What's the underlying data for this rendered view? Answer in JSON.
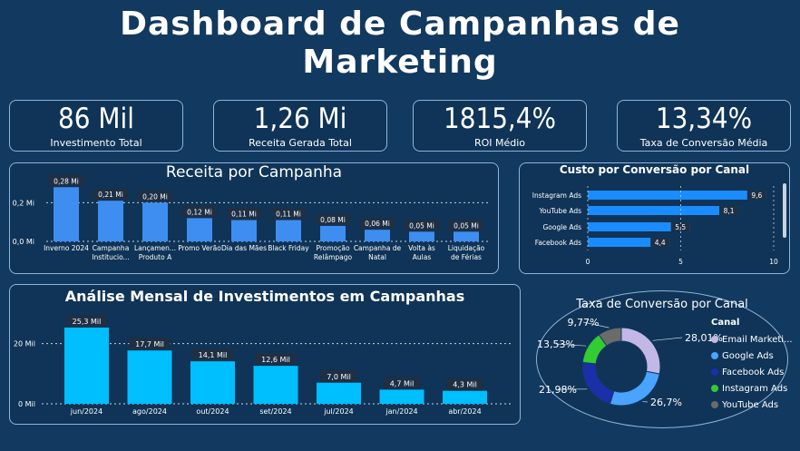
{
  "title_line1": "Dashboard de Campanhas  de",
  "title_line2": "Marketing",
  "kpis": [
    {
      "value": "86 Mil",
      "label": "Investimento Total"
    },
    {
      "value": "1,26 Mi",
      "label": "Receita Gerada Total"
    },
    {
      "value": "1815,4%",
      "label": "ROI Médio"
    },
    {
      "value": "13,34%",
      "label": "Taxa de Conversão Média"
    }
  ],
  "colors": {
    "background": "#12395f",
    "bar_blue": "#3d8ef0",
    "bar_cyan": "#00bfff",
    "channel_bar": "#1a8cff"
  },
  "chart_data": [
    {
      "type": "bar",
      "title": "Receita por Campanha",
      "categories": [
        "Inverno 2024",
        "Campanha Institucio...",
        "Lançamen... Produto A",
        "Promo Verão",
        "Dia das Mães",
        "Black Friday",
        "Promoção Relâmpago",
        "Campanha de Natal",
        "Volta às Aulas",
        "Liquidação de Férias"
      ],
      "values": [
        0.28,
        0.21,
        0.2,
        0.12,
        0.11,
        0.11,
        0.08,
        0.06,
        0.05,
        0.05
      ],
      "data_labels": [
        "0,28 Mi",
        "0,21 Mi",
        "0,20 Mi",
        "0,12 Mi",
        "0,11 Mi",
        "0,11 Mi",
        "0,08 Mi",
        "0,06 Mi",
        "0,05 Mi",
        "0,05 Mi"
      ],
      "y_ticks": [
        "0,2 Mi",
        "0,0 Mi"
      ],
      "ylim": [
        0,
        0.3
      ]
    },
    {
      "type": "bar",
      "orientation": "horizontal",
      "title": "Custo por Conversão por Canal",
      "categories": [
        "Instagram Ads",
        "YouTube Ads",
        "Google Ads",
        "Facebook Ads"
      ],
      "values": [
        9.6,
        8.1,
        5.5,
        4.4
      ],
      "data_labels": [
        "9,6",
        "8,1",
        "5,5",
        "4,4"
      ],
      "x_ticks": [
        "0",
        "5",
        "10"
      ],
      "xlim": [
        0,
        10
      ]
    },
    {
      "type": "bar",
      "title": "Análise Mensal de Investimentos em Campanhas",
      "categories": [
        "jun/2024",
        "ago/2024",
        "out/2024",
        "set/2024",
        "jul/2024",
        "jan/2024",
        "abr/2024"
      ],
      "values": [
        25.3,
        17.7,
        14.1,
        12.6,
        7.0,
        4.7,
        4.3
      ],
      "data_labels": [
        "25,3 Mil",
        "17,7 Mil",
        "14,1 Mil",
        "12,6 Mil",
        "7,0 Mil",
        "4,7 Mil",
        "4,3 Mil"
      ],
      "y_ticks": [
        "20 Mil",
        "0 Mil"
      ],
      "ylim": [
        0,
        28
      ]
    },
    {
      "type": "pie",
      "title": "Taxa de Conversão por Canal",
      "legend_title": "Canal",
      "categories": [
        "Email Marketi...",
        "Google Ads",
        "Facebook Ads",
        "Instagram Ads",
        "YouTube Ads"
      ],
      "values": [
        28.01,
        26.7,
        21.98,
        13.53,
        9.77
      ],
      "data_labels": [
        "28,01%",
        "26,7%",
        "21,98%",
        "13,53%",
        "9,77%"
      ],
      "colors": [
        "#c3b7e6",
        "#4aa3ff",
        "#1a2fa8",
        "#33cc33",
        "#6b6b6b"
      ]
    }
  ]
}
